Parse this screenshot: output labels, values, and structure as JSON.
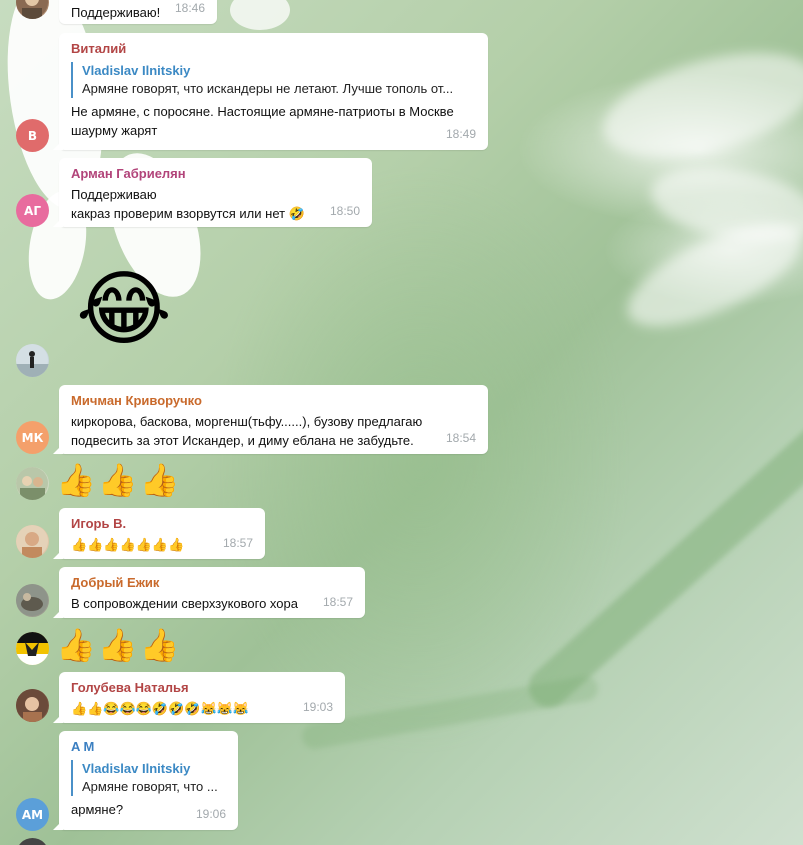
{
  "messages": [
    {
      "text": "Поддерживаю!",
      "time": "18:46"
    },
    {
      "sender": "Виталий",
      "avatar_initials": "В",
      "reply_name": "Vladislav Ilnitskiy",
      "reply_text": "Армяне говорят, что искандеры не летают. Лучше тополь от...",
      "text": "Не армяне, с поросяне. Настоящие армяне-патриоты в Москве\nшаурму жарят",
      "time": "18:49"
    },
    {
      "sender": "Арман Габриелян",
      "avatar_initials": "АГ",
      "text": "Поддерживаю\nкакраз проверим взорвутся или нет 🤣",
      "time": "18:50"
    },
    {
      "sticker": "😂"
    },
    {
      "sender": "Мичман Криворучко",
      "avatar_initials": "МК",
      "text": "киркорова, баскова, моргенш(тьфу......), бузову предлагаю\nподвесить за этот Искандер, и диму еблана не забудьте.",
      "time": "18:54"
    },
    {
      "emoji": "👍👍👍"
    },
    {
      "sender": "Игорь В.",
      "text": "👍👍👍👍👍👍👍",
      "time": "18:57"
    },
    {
      "sender": "Добрый Ежик",
      "text": "В сопровождении сверхзукового хора",
      "time": "18:57"
    },
    {
      "emoji": "👍👍👍"
    },
    {
      "sender": "Голубева Наталья",
      "text": "👍👍😂😂😂🤣🤣🤣😹😹😹",
      "time": "19:03"
    },
    {
      "sender": "A M",
      "avatar_initials": "AM",
      "reply_name": "Vladislav Ilnitskiy",
      "reply_text": "Армяне говорят, что ...",
      "text": "армяне?",
      "time": "19:06"
    }
  ],
  "colors": {
    "vitaliy": "#b24545",
    "arman": "#b2447a",
    "michman": "#c96a2c",
    "igor": "#b24545",
    "ezhik": "#c96a2c",
    "golubeva": "#b24545",
    "am": "#3b7fc1",
    "reply_accent": "#3b89c4"
  }
}
